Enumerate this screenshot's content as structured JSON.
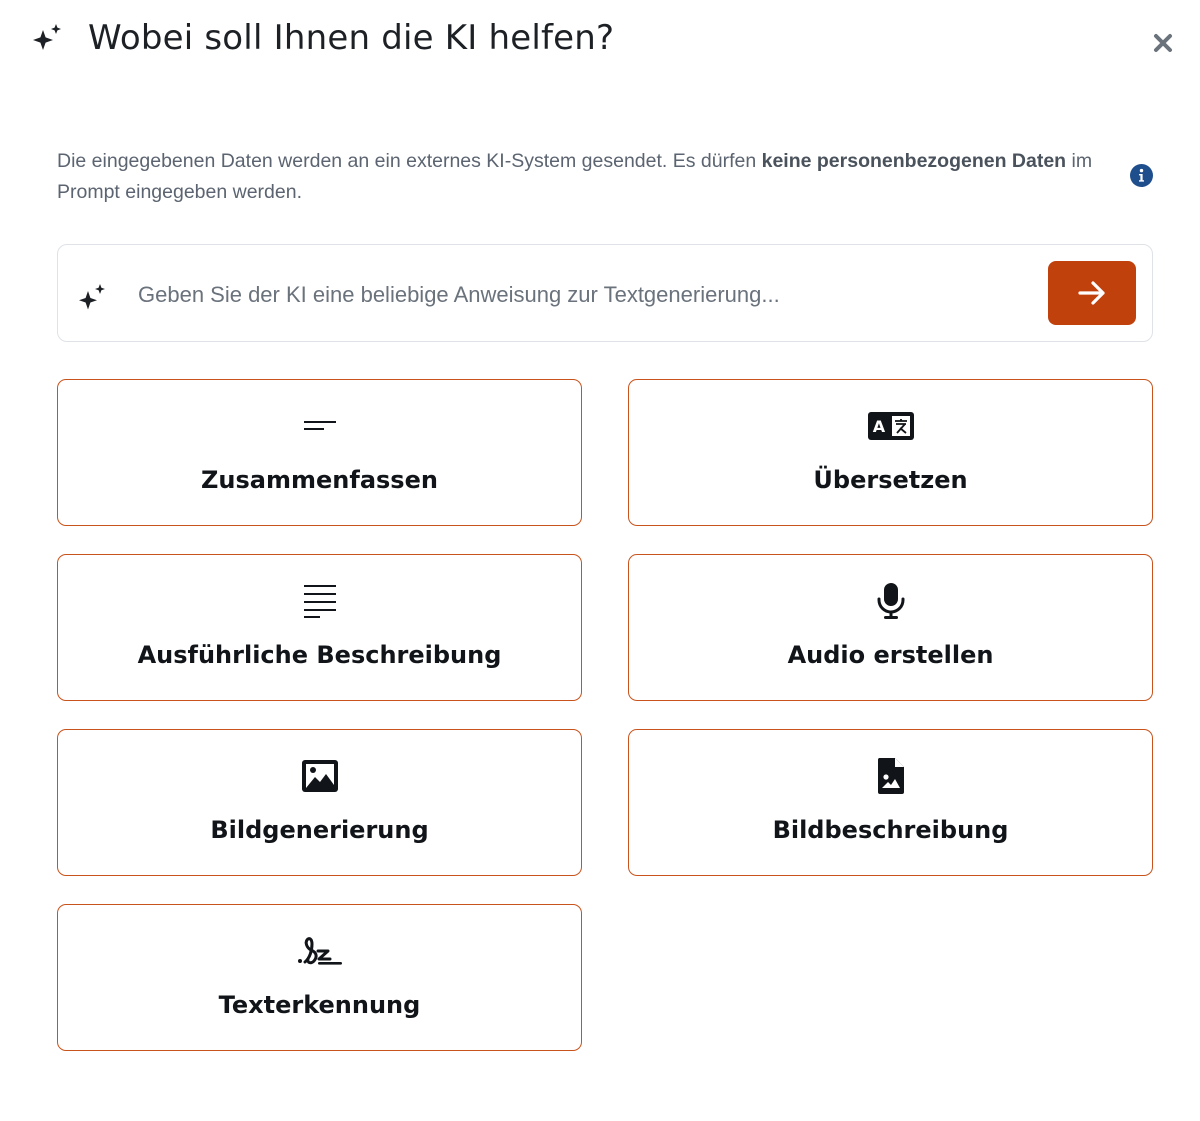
{
  "header": {
    "title": "Wobei soll Ihnen die KI helfen?",
    "icon": "sparkles-icon",
    "close_icon": "close-icon"
  },
  "notice": {
    "text_before": "Die eingegebenen Daten werden an ein externes KI-System gesendet. Es dürfen ",
    "text_bold": "keine personenbezogenen Daten",
    "text_after": " im Prompt eingegeben werden.",
    "info_icon": "info-icon"
  },
  "prompt": {
    "placeholder": "Geben Sie der KI eine beliebige Anweisung zur Textgenerierung...",
    "value": "",
    "send_icon": "arrow-right-icon"
  },
  "actions": [
    {
      "label": "Zusammenfassen",
      "icon": "short-text-icon"
    },
    {
      "label": "Übersetzen",
      "icon": "translate-icon"
    },
    {
      "label": "Ausführliche Beschreibung",
      "icon": "long-text-icon"
    },
    {
      "label": "Audio erstellen",
      "icon": "microphone-icon"
    },
    {
      "label": "Bildgenerierung",
      "icon": "image-icon"
    },
    {
      "label": "Bildbeschreibung",
      "icon": "image-file-icon"
    },
    {
      "label": "Texterkennung",
      "icon": "signature-icon"
    }
  ],
  "colors": {
    "accent": "#c0410c",
    "tile_border": "#c9531c",
    "info": "#1f4e8c",
    "text": "#1d2125",
    "muted": "#5b6470"
  }
}
